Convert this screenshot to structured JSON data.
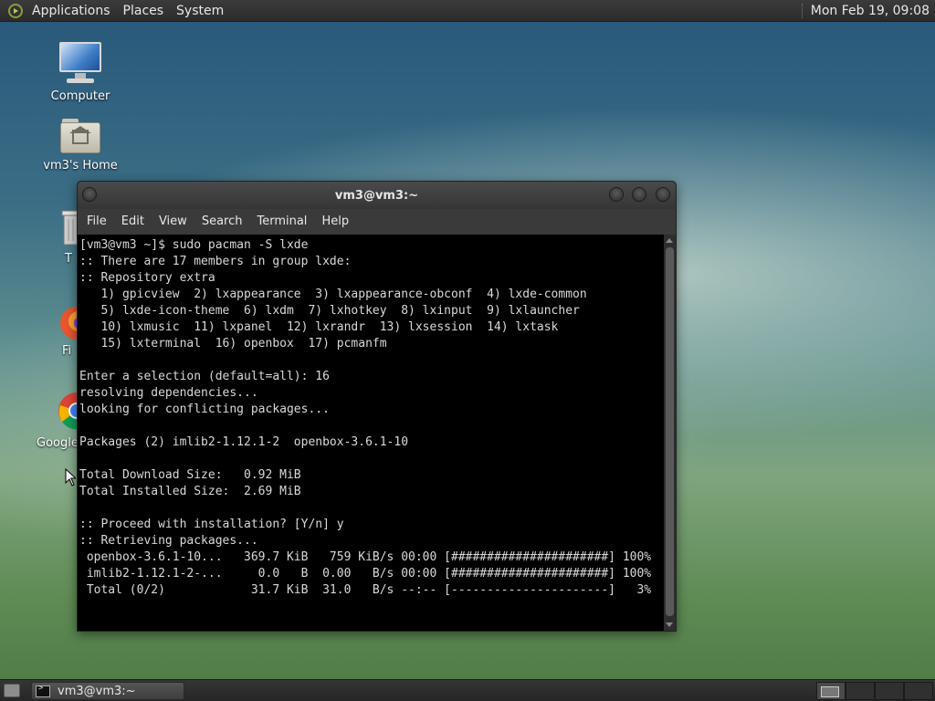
{
  "top_panel": {
    "menus": [
      "Applications",
      "Places",
      "System"
    ],
    "clock": "Mon Feb 19, 09:08"
  },
  "desktop": {
    "icons": [
      {
        "label": "Computer",
        "icon": "computer-icon"
      },
      {
        "label": "vm3's Home",
        "icon": "home-folder-icon"
      },
      {
        "label": "T",
        "icon": "trash-icon"
      },
      {
        "label": "Fi",
        "icon": "firefox-icon"
      },
      {
        "label": "Google",
        "icon": "chrome-icon"
      }
    ]
  },
  "terminal": {
    "title": "vm3@vm3:~",
    "menu": [
      "File",
      "Edit",
      "View",
      "Search",
      "Terminal",
      "Help"
    ],
    "lines": [
      "[vm3@vm3 ~]$ sudo pacman -S lxde",
      ":: There are 17 members in group lxde:",
      ":: Repository extra",
      "   1) gpicview  2) lxappearance  3) lxappearance-obconf  4) lxde-common",
      "   5) lxde-icon-theme  6) lxdm  7) lxhotkey  8) lxinput  9) lxlauncher",
      "   10) lxmusic  11) lxpanel  12) lxrandr  13) lxsession  14) lxtask",
      "   15) lxterminal  16) openbox  17) pcmanfm",
      "",
      "Enter a selection (default=all): 16",
      "resolving dependencies...",
      "looking for conflicting packages...",
      "",
      "Packages (2) imlib2-1.12.1-2  openbox-3.6.1-10",
      "",
      "Total Download Size:   0.92 MiB",
      "Total Installed Size:  2.69 MiB",
      "",
      ":: Proceed with installation? [Y/n] y",
      ":: Retrieving packages...",
      " openbox-3.6.1-10...   369.7 KiB   759 KiB/s 00:00 [######################] 100%",
      " imlib2-1.12.1-2-...     0.0   B  0.00   B/s 00:00 [######################] 100%",
      " Total (0/2)            31.7 KiB  31.0   B/s --:-- [----------------------]   3%"
    ]
  },
  "taskbar": {
    "task_label": "vm3@vm3:~",
    "workspaces": 4,
    "active_workspace": 1
  }
}
